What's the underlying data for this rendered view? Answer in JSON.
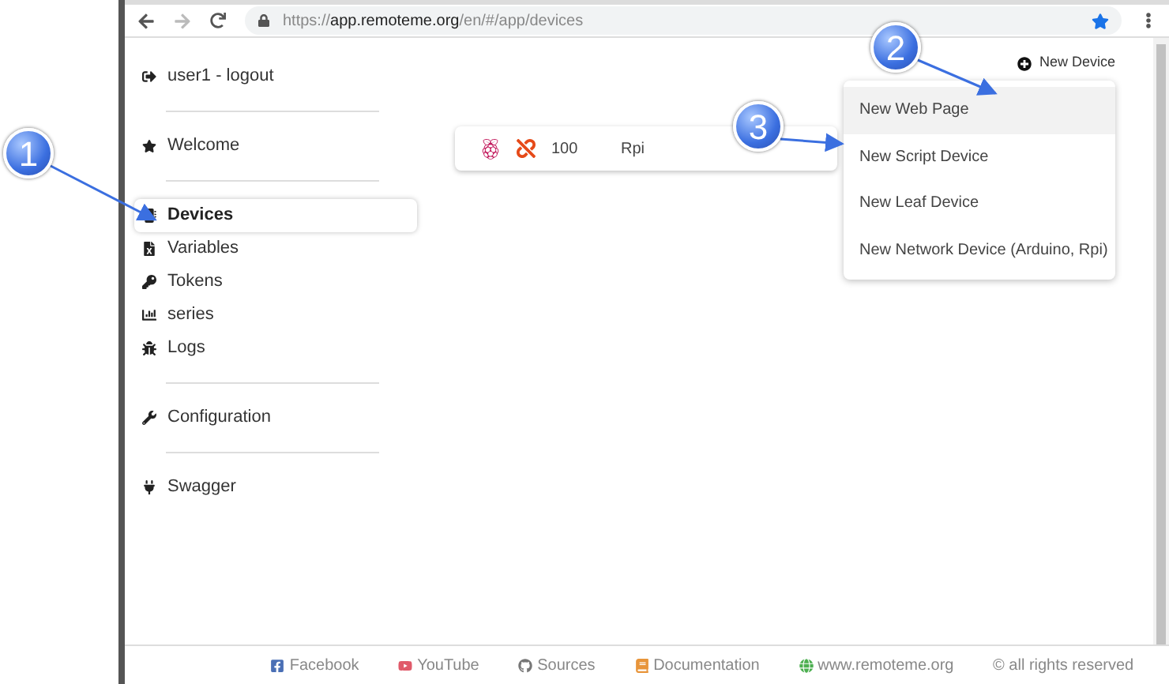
{
  "browser": {
    "url": "https://**app.remoteme.org**/en/#/app/devices",
    "bookmarked": true
  },
  "sidebar": {
    "sections": [
      [
        {
          "label": "user1 - logout",
          "selected": false
        }
      ],
      [
        {
          "label": "Welcome",
          "selected": false
        }
      ],
      [
        {
          "label": "Devices",
          "selected": true
        },
        {
          "label": "Variables",
          "selected": false
        },
        {
          "label": "Tokens",
          "selected": false
        },
        {
          "label": "series",
          "selected": false
        },
        {
          "label": "Logs",
          "selected": false
        }
      ],
      [
        {
          "label": "Configuration",
          "selected": false
        }
      ],
      [
        {
          "label": "Swagger",
          "selected": false
        }
      ]
    ]
  },
  "devices": [
    {
      "id": "100",
      "name": "Rpi",
      "connected": false
    }
  ],
  "new_device": {
    "label": "New Device",
    "menu": [
      {
        "label": "New Web Page",
        "selected": true
      },
      {
        "label": "New Script Device",
        "selected": false
      },
      {
        "label": "New Leaf Device",
        "selected": false
      },
      {
        "label": "New Network Device (Arduino, Rpi)",
        "selected": false
      }
    ]
  },
  "footer": [
    "Facebook",
    "YouTube",
    "Sources",
    "Documentation",
    "www.remoteme.org",
    "© all rights reserved"
  ],
  "callouts": [
    "1",
    "2",
    "3"
  ]
}
